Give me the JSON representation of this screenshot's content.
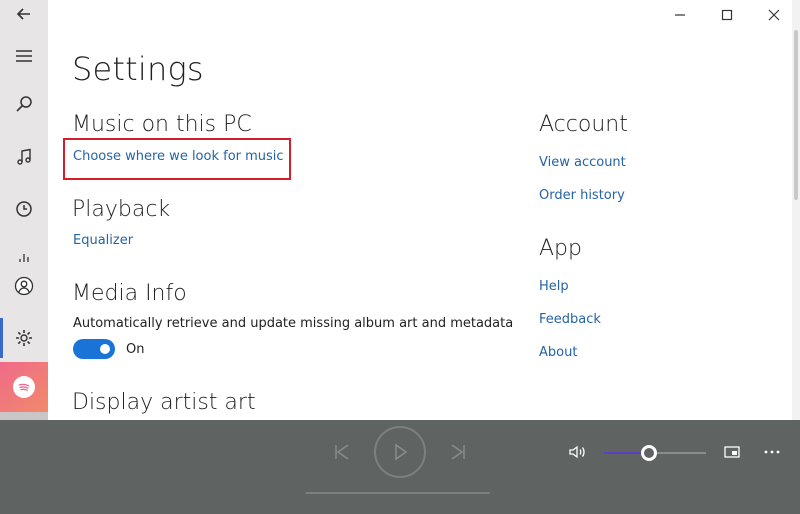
{
  "sidebar": {
    "items": [
      {
        "name": "back",
        "icon": "back-arrow-icon"
      },
      {
        "name": "menu",
        "icon": "hamburger-icon"
      },
      {
        "name": "search",
        "icon": "search-icon"
      },
      {
        "name": "my-music",
        "icon": "music-note-icon"
      },
      {
        "name": "recent",
        "icon": "clock-icon"
      },
      {
        "name": "now-playing",
        "icon": "equalizer-bars-icon"
      },
      {
        "name": "account",
        "icon": "person-icon"
      },
      {
        "name": "settings",
        "icon": "gear-icon",
        "active": true
      },
      {
        "name": "spotify",
        "icon": "spotify-icon"
      }
    ]
  },
  "window": {
    "controls": [
      "minimize",
      "maximize",
      "close"
    ]
  },
  "page": {
    "title": "Settings"
  },
  "music_on_pc": {
    "title": "Music on this PC",
    "link": "Choose where we look for music"
  },
  "playback": {
    "title": "Playback",
    "link": "Equalizer"
  },
  "media_info": {
    "title": "Media Info",
    "description": "Automatically retrieve and update missing album art and metadata",
    "toggle_state": "On",
    "toggle_on": true
  },
  "display_artist_art": {
    "title": "Display artist art"
  },
  "account": {
    "title": "Account",
    "links": [
      "View account",
      "Order history"
    ]
  },
  "app": {
    "title": "App",
    "links": [
      "Help",
      "Feedback",
      "About"
    ]
  },
  "player": {
    "progress": 0,
    "volume": 0.43
  },
  "colors": {
    "accent": "#1a73d6",
    "link": "#2563a6",
    "highlight": "#d21f2a",
    "player_bg": "#5f6462",
    "sidebar_bg": "#e7e5e6"
  }
}
